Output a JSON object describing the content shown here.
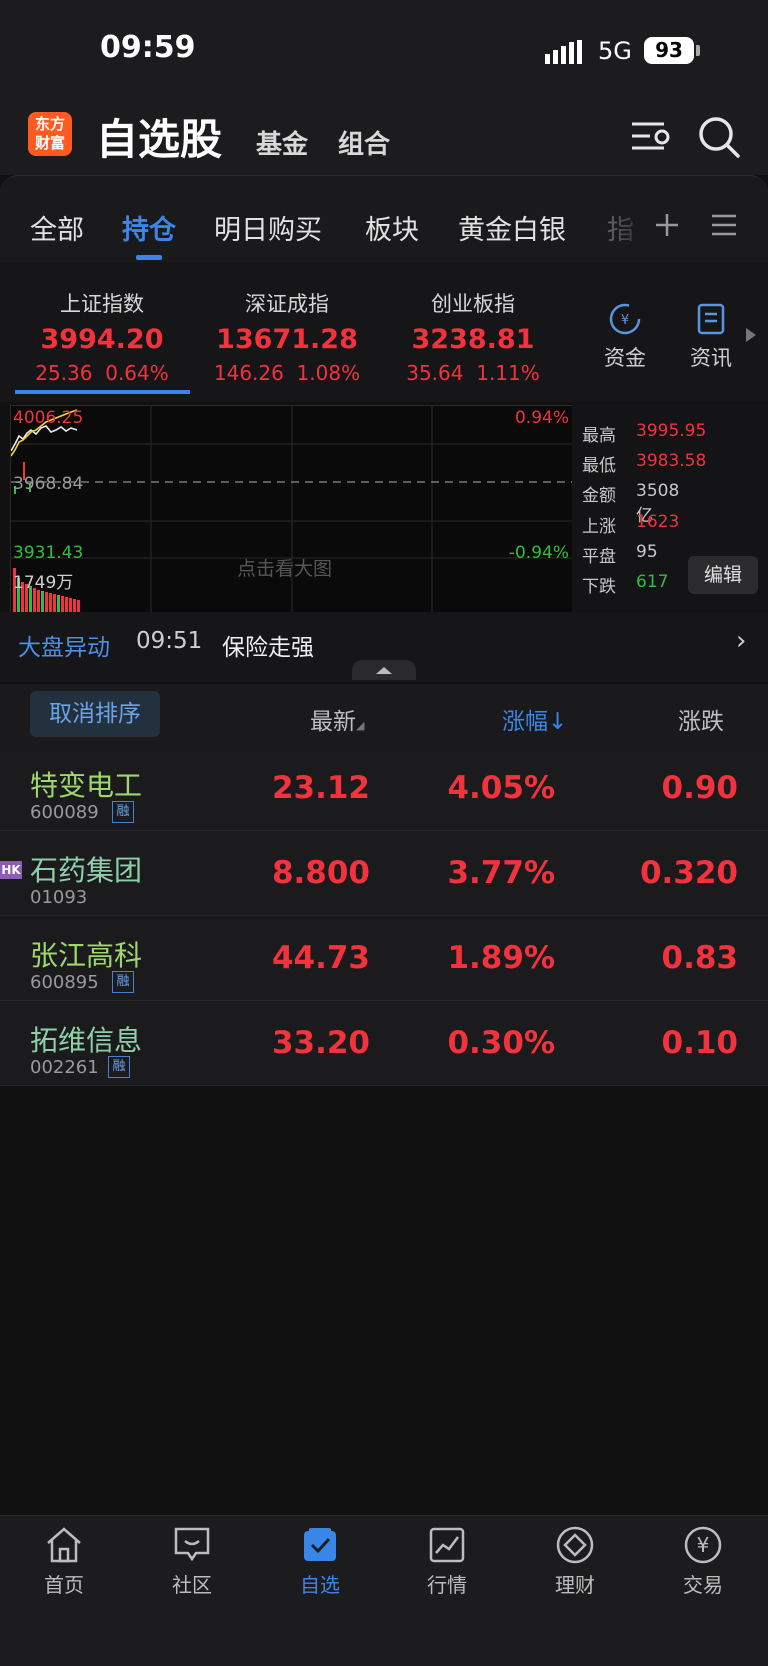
{
  "status_bar": {
    "time": "09:59",
    "network": "5G",
    "battery": "93"
  },
  "header": {
    "logo_line1": "东方",
    "logo_line2": "财富",
    "title": "自选股",
    "tabs": [
      "基金",
      "组合"
    ],
    "icons": [
      "list-settings-icon",
      "search-icon"
    ]
  },
  "category_tabs": {
    "items": [
      "全部",
      "持仓",
      "明日购买",
      "板块",
      "黄金白银",
      "指"
    ],
    "active": "持仓",
    "icons": [
      "plus-icon",
      "menu-icon"
    ]
  },
  "indices": [
    {
      "name": "上证指数",
      "value": "3994.20",
      "change": "25.36",
      "percent": "0.64%"
    },
    {
      "name": "深证成指",
      "value": "13671.28",
      "change": "146.26",
      "percent": "1.08%"
    },
    {
      "name": "创业板指",
      "value": "3238.81",
      "change": "35.64",
      "percent": "1.11%"
    }
  ],
  "side_buttons": {
    "funds": "资金",
    "news": "资讯"
  },
  "mini_chart": {
    "top_price": "4006.25",
    "mid_price": "3968.84",
    "bottom_price": "3931.43",
    "top_pct": "0.94%",
    "bottom_pct": "-0.94%",
    "volume": "1749万",
    "hint": "点击看大图"
  },
  "stats": {
    "high_label": "最高",
    "high": "3995.95",
    "low_label": "最低",
    "low": "3983.58",
    "amount_label": "金额",
    "amount": "3508亿",
    "up_label": "上涨",
    "up": "1623",
    "flat_label": "平盘",
    "flat": "95",
    "down_label": "下跌",
    "down": "617",
    "edit": "编辑"
  },
  "market_alert": {
    "tag": "大盘异动",
    "time": "09:51",
    "text": "保险走强"
  },
  "list_header": {
    "cancel_sort": "取消排序",
    "latest": "最新",
    "change_pct": "涨幅↓",
    "change": "涨跌"
  },
  "stocks": [
    {
      "name": "特变电工",
      "code": "600089",
      "badge": "融",
      "price": "23.12",
      "pct": "4.05%",
      "chg": "0.90"
    },
    {
      "name": "石药集团",
      "code": "01093",
      "market": "HK",
      "price": "8.800",
      "pct": "3.77%",
      "chg": "0.320"
    },
    {
      "name": "张江高科",
      "code": "600895",
      "badge": "融",
      "price": "44.73",
      "pct": "1.89%",
      "chg": "0.83"
    },
    {
      "name": "拓维信息",
      "code": "002261",
      "badge": "融",
      "price": "33.20",
      "pct": "0.30%",
      "chg": "0.10"
    }
  ],
  "bottom_nav": {
    "items": [
      {
        "label": "首页",
        "icon": "home-icon"
      },
      {
        "label": "社区",
        "icon": "community-icon"
      },
      {
        "label": "自选",
        "icon": "watchlist-icon"
      },
      {
        "label": "行情",
        "icon": "market-chart-icon"
      },
      {
        "label": "理财",
        "icon": "wealth-icon"
      },
      {
        "label": "交易",
        "icon": "trade-yen-icon"
      }
    ],
    "active": "自选"
  },
  "colors": {
    "accent": "#3a86e8",
    "up": "#f2323c",
    "down": "#2fbf3a",
    "brand": "#ff5a1f"
  }
}
